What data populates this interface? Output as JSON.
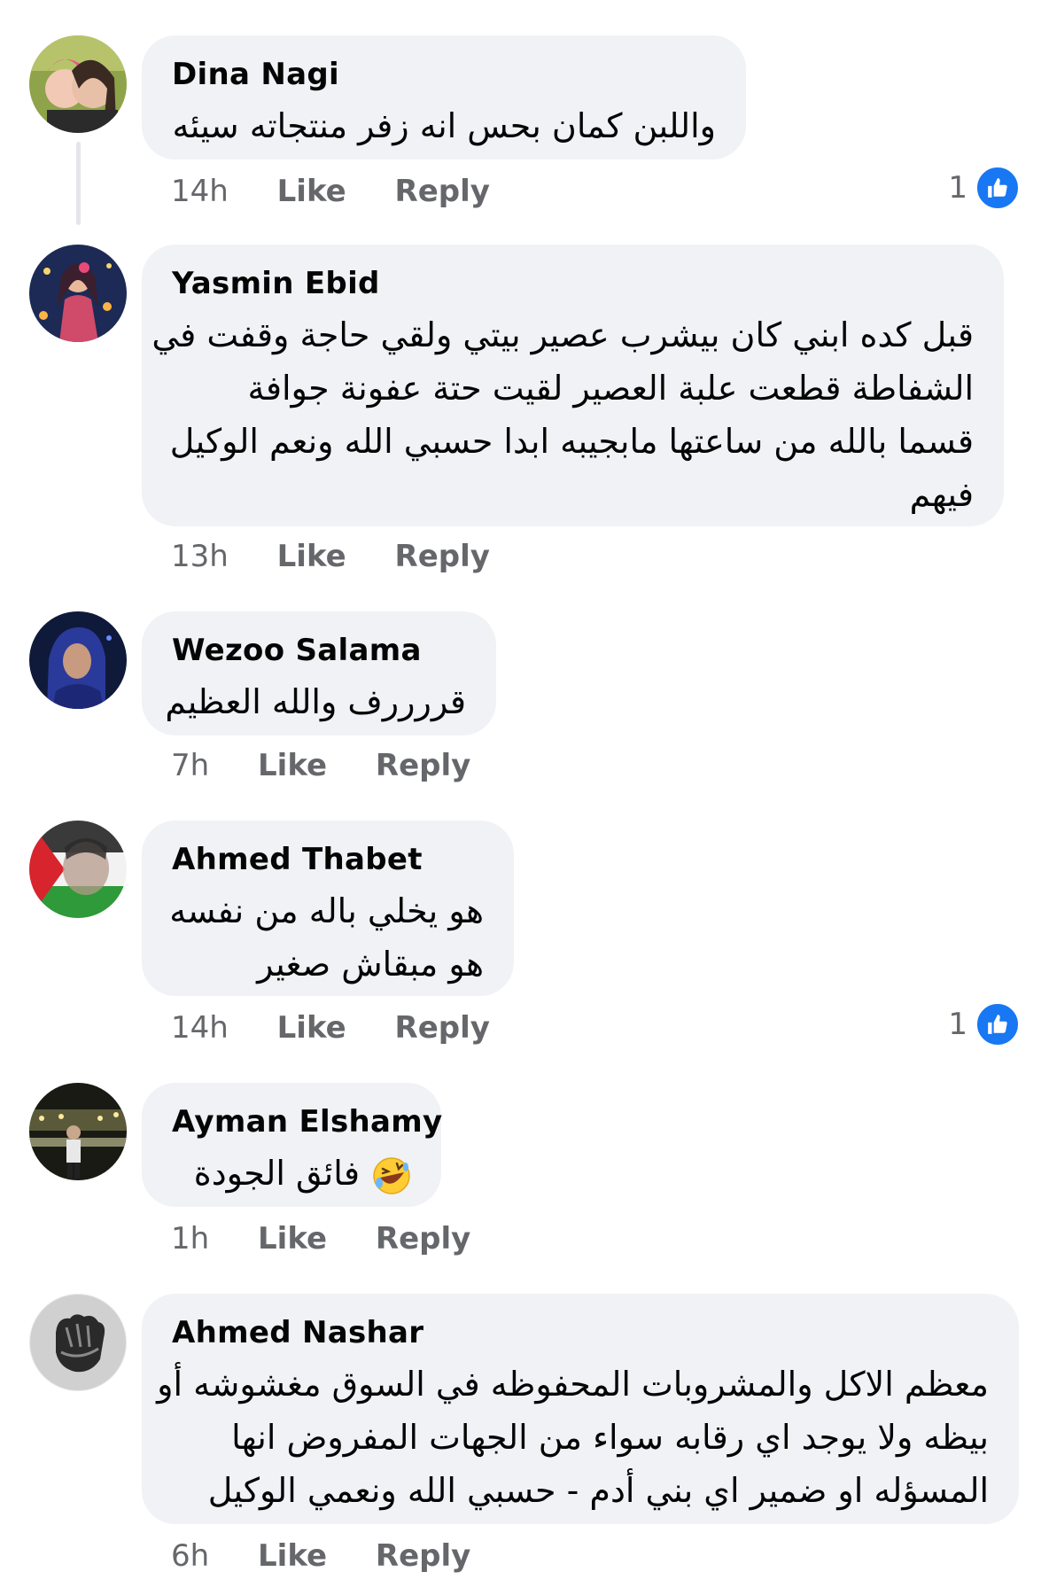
{
  "comments": [
    {
      "name": "Dina Nagi",
      "lines": [
        "واللبن كمان بحس انه زفر منتجاته سيئه"
      ],
      "time": "14h",
      "like": "Like",
      "reply": "Reply",
      "reactions": "1"
    },
    {
      "name": "Yasmin Ebid",
      "lines": [
        "قبل كده ابني كان بيشرب عصير بيتي ولقي حاجة وقفت في",
        "الشفاطة قطعت علبة العصير لقيت حتة عفونة جوافة",
        "قسما بالله من ساعتها مابجيبه ابدا حسبي الله ونعم الوكيل",
        "فيهم"
      ],
      "time": "13h",
      "like": "Like",
      "reply": "Reply"
    },
    {
      "name": "Wezoo Salama",
      "lines": [
        "قررررف والله العظيم"
      ],
      "time": "7h",
      "like": "Like",
      "reply": "Reply"
    },
    {
      "name": "Ahmed Thabet",
      "lines": [
        "هو يخلي باله من نفسه",
        "هو مبقاش صغير"
      ],
      "time": "14h",
      "like": "Like",
      "reply": "Reply",
      "reactions": "1"
    },
    {
      "name": "Ayman Elshamy",
      "lines": [
        "فائق الجودة"
      ],
      "emoji": "rolling-on-floor-laughing",
      "time": "1h",
      "like": "Like",
      "reply": "Reply"
    },
    {
      "name": "Ahmed Nashar",
      "lines": [
        "معظم الاكل والمشروبات المحفوظه في السوق مغشوشه أو",
        "بيظه ولا يوجد اي رقابه سواء من الجهات المفروض انها",
        "المسؤله او ضمير اي بني أدم  -  حسبي الله ونعمي الوكيل"
      ],
      "time": "6h",
      "like": "Like",
      "reply": "Reply"
    }
  ],
  "colors": {
    "bubble": "#f0f2f5",
    "meta": "#65676b",
    "like_blue": "#1877f2"
  }
}
